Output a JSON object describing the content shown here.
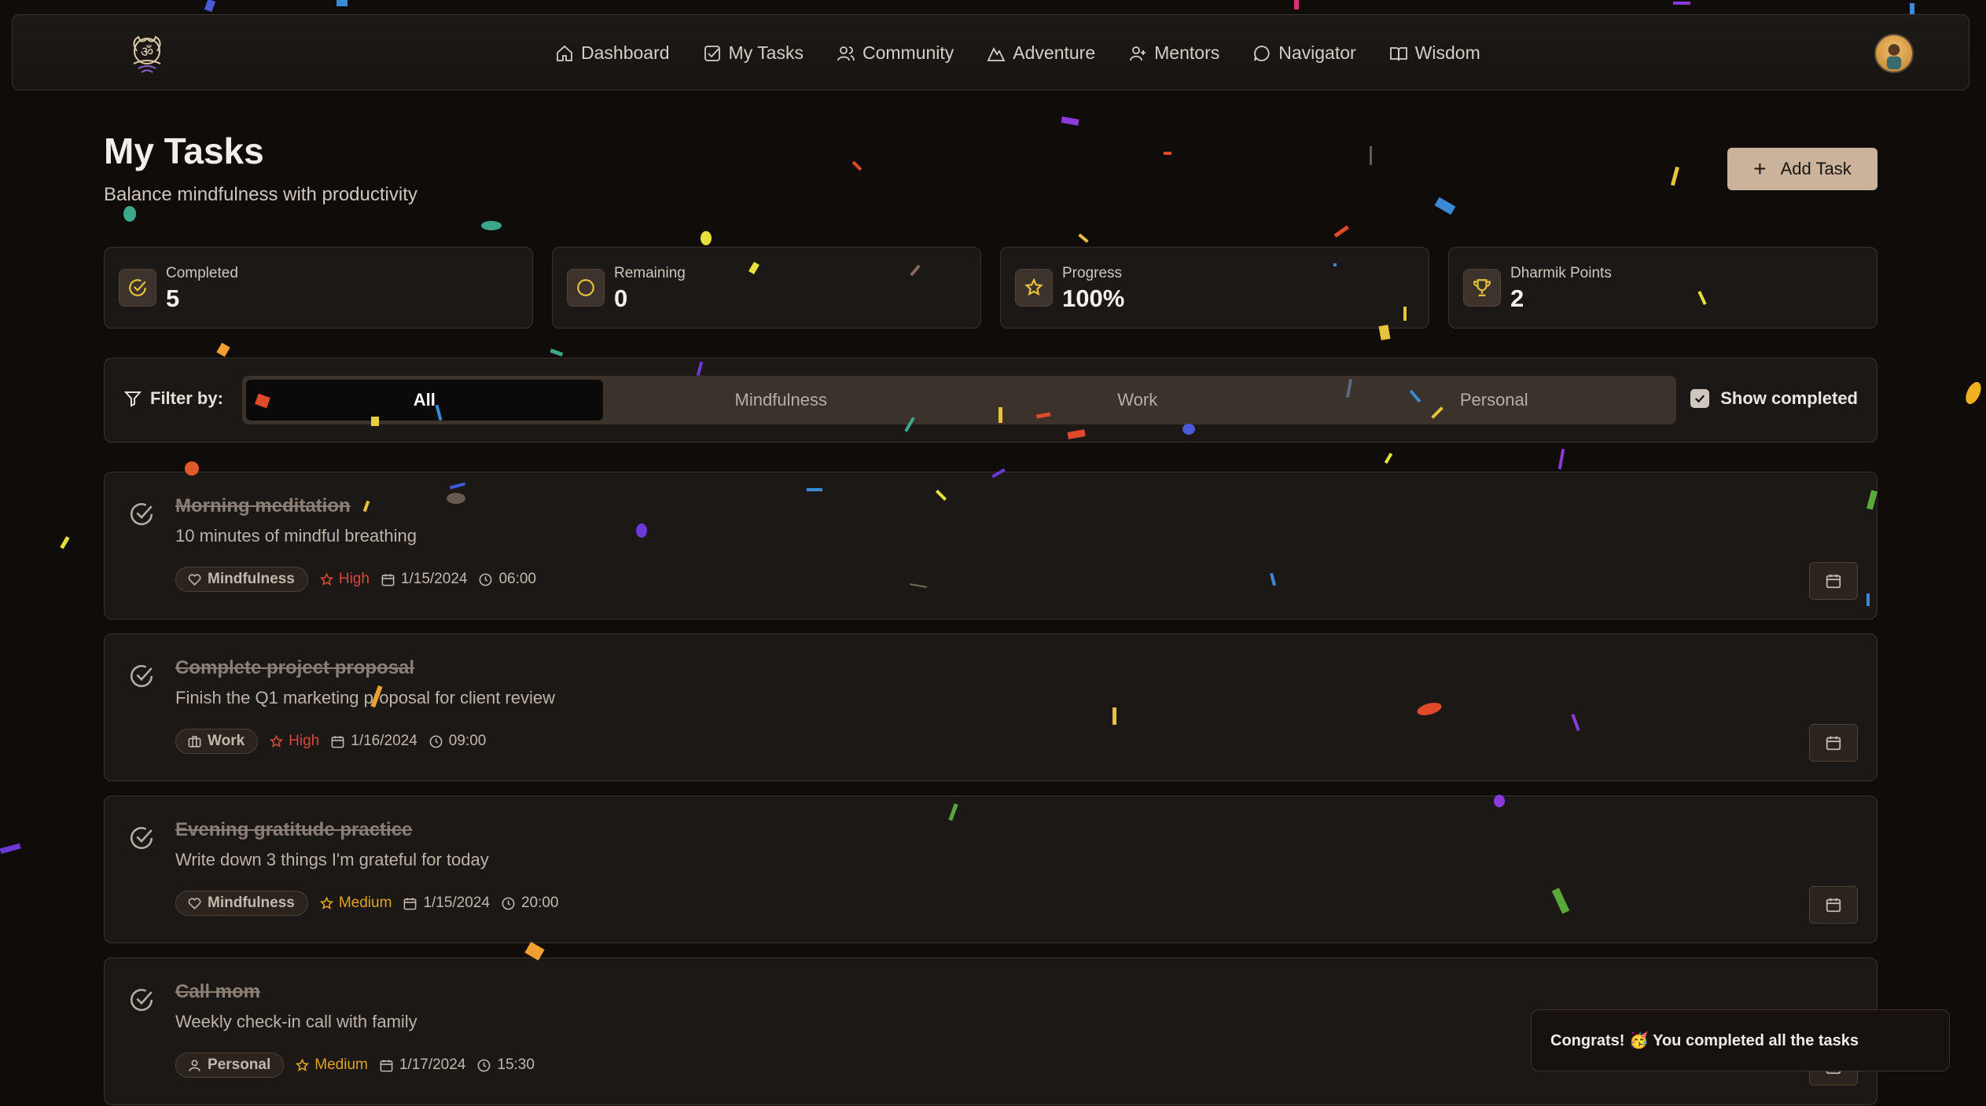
{
  "nav": {
    "logo_icon": "om-lotus-logo",
    "links": [
      {
        "label": "Dashboard",
        "icon": "home-icon"
      },
      {
        "label": "My Tasks",
        "icon": "checkbox-icon"
      },
      {
        "label": "Community",
        "icon": "users-icon"
      },
      {
        "label": "Adventure",
        "icon": "mountain-icon"
      },
      {
        "label": "Mentors",
        "icon": "user-group-icon"
      },
      {
        "label": "Navigator",
        "icon": "chat-bubble-icon"
      },
      {
        "label": "Wisdom",
        "icon": "book-icon"
      }
    ],
    "avatar": "user-avatar"
  },
  "header": {
    "title": "My Tasks",
    "subtitle": "Balance mindfulness with productivity",
    "add_task_label": "Add Task"
  },
  "stats": [
    {
      "label": "Completed",
      "value": "5",
      "icon": "check-circle-icon"
    },
    {
      "label": "Remaining",
      "value": "0",
      "icon": "circle-icon"
    },
    {
      "label": "Progress",
      "value": "100%",
      "icon": "star-icon"
    },
    {
      "label": "Dharmik Points",
      "value": "2",
      "icon": "trophy-icon"
    }
  ],
  "filter": {
    "label": "Filter by:",
    "options": [
      "All",
      "Mindfulness",
      "Work",
      "Personal"
    ],
    "selected": "All",
    "show_completed_label": "Show completed",
    "show_completed_checked": true
  },
  "tasks": [
    {
      "title": "Morning meditation",
      "description": "10 minutes of mindful breathing",
      "category": "Mindfulness",
      "category_icon": "heart-icon",
      "priority": "High",
      "date": "1/15/2024",
      "time": "06:00",
      "completed": true
    },
    {
      "title": "Complete project proposal",
      "description": "Finish the Q1 marketing proposal for client review",
      "category": "Work",
      "category_icon": "briefcase-icon",
      "priority": "High",
      "date": "1/16/2024",
      "time": "09:00",
      "completed": true
    },
    {
      "title": "Evening gratitude practice",
      "description": "Write down 3 things I'm grateful for today",
      "category": "Mindfulness",
      "category_icon": "heart-icon",
      "priority": "Medium",
      "date": "1/15/2024",
      "time": "20:00",
      "completed": true
    },
    {
      "title": "Call mom",
      "description": "Weekly check-in call with family",
      "category": "Personal",
      "category_icon": "user-icon",
      "priority": "Medium",
      "date": "1/17/2024",
      "time": "15:30",
      "completed": true
    }
  ],
  "toast": {
    "message": "Congrats! 🥳 You completed all the tasks"
  },
  "colors": {
    "background": "#0f0c0a",
    "card": "#1c1815",
    "accent": "#cbb39b",
    "high": "#d9483b",
    "medium": "#e3a322",
    "gold": "#e8c23a"
  }
}
